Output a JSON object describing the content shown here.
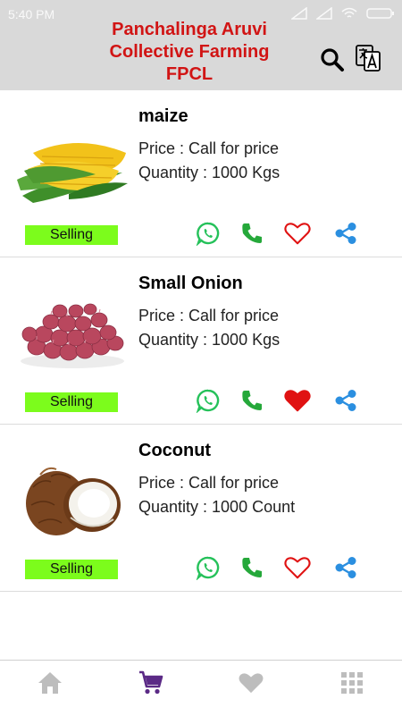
{
  "status_bar": {
    "time": "5:40 PM"
  },
  "header": {
    "title_lines": [
      "Panchalinga Aruvi",
      "Collective Farming",
      "FPCL"
    ],
    "icons": [
      "search-icon",
      "translate-icon"
    ]
  },
  "products": [
    {
      "name": "maize",
      "price": "Price : Call for price",
      "quantity": "Quantity : 1000 Kgs",
      "badge": "Selling",
      "favorited": false,
      "image": "maize-image"
    },
    {
      "name": "Small Onion",
      "price": "Price : Call for price",
      "quantity": "Quantity : 1000 Kgs",
      "badge": "Selling",
      "favorited": true,
      "image": "small-onion-image"
    },
    {
      "name": "Coconut",
      "price": "Price : Call for price",
      "quantity": "Quantity : 1000 Count",
      "badge": "Selling",
      "favorited": false,
      "image": "coconut-image"
    }
  ],
  "bottom_nav": {
    "items": [
      "home-icon",
      "cart-icon",
      "heart-icon",
      "grid-icon"
    ],
    "active": "cart-icon"
  },
  "colors": {
    "header_bg": "#d9d9d9",
    "title": "#d11414",
    "badge": "#7cfc1c",
    "whatsapp": "#25c15a",
    "call": "#25a83a",
    "favorite": "#e01212",
    "share": "#2b8fe0",
    "active_nav": "#5b2a86",
    "inactive_nav": "#bdbdbd"
  }
}
